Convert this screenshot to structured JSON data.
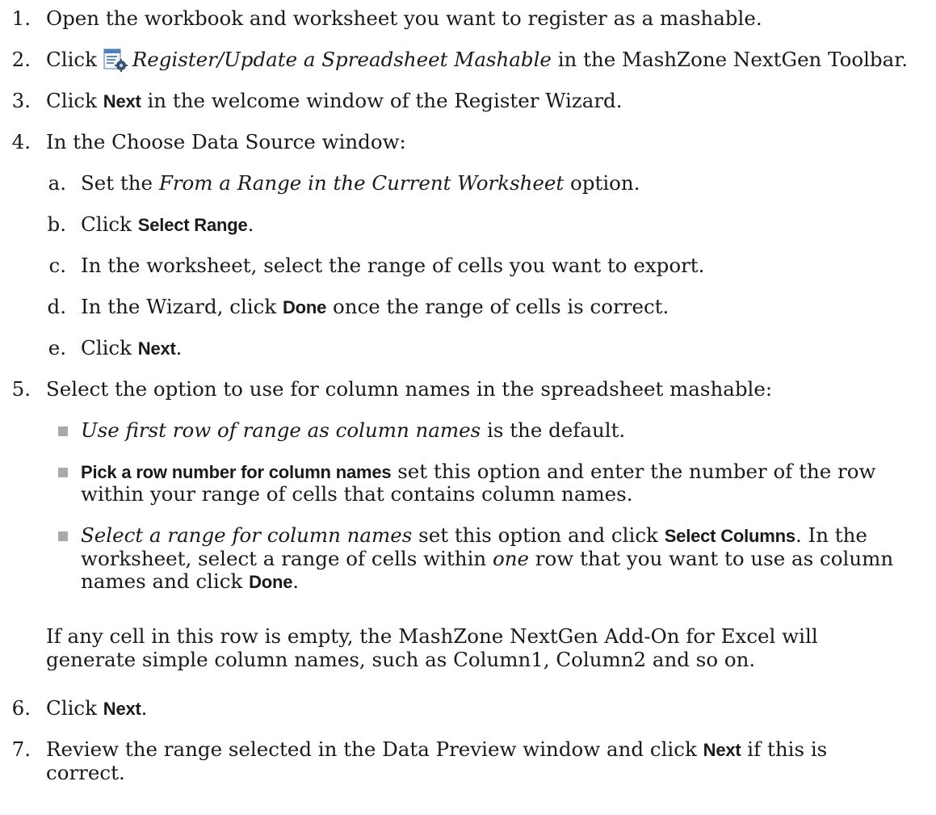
{
  "steps": [
    {
      "num": "1.",
      "text": "Open the workbook and worksheet you want to register as a mashable."
    },
    {
      "num": "2.",
      "pre": "Click ",
      "italic": "Register/Update a Spreadsheet Mashable",
      "post": " in the MashZone NextGen Toolbar.",
      "icon": "spreadsheet-register-icon"
    },
    {
      "num": "3.",
      "pre": "Click ",
      "bold": "Next",
      "post": " in the welcome window of the Register Wizard."
    },
    {
      "num": "4.",
      "text": "In the Choose Data Source window:"
    },
    {
      "num": "5.",
      "text": "Select the option to use for column names in the spreadsheet mashable:"
    },
    {
      "num": "6.",
      "pre": "Click ",
      "bold": "Next",
      "post": "."
    },
    {
      "num": "7.",
      "pre": "Review the range selected in the Data Preview window and click ",
      "bold": "Next",
      "post": " if this is",
      "cont": "correct."
    }
  ],
  "substeps": [
    {
      "letter": "a.",
      "pre": "Set the ",
      "italic": "From a Range in the Current Worksheet",
      "post": " option."
    },
    {
      "letter": "b.",
      "pre": "Click ",
      "bold": "Select Range",
      "post": "."
    },
    {
      "letter": "c.",
      "text": "In the worksheet, select the range of cells you want to export."
    },
    {
      "letter": "d.",
      "pre": "In the Wizard, click ",
      "bold": "Done",
      "post": " once the range of cells is correct."
    },
    {
      "letter": "e.",
      "pre": "Click ",
      "bold": "Next",
      "post": "."
    }
  ],
  "options": [
    {
      "italic": "Use first row of range as column names",
      "post": " is the default."
    },
    {
      "bold": "Pick a row number for column names",
      "post": " set this option and enter the number of the row",
      "cont": "within your range of cells that contains column names."
    },
    {
      "italic": "Select a range for column names",
      "mid": " set this option and click ",
      "bold": "Select Columns",
      "post": ". In the",
      "cont_pre": "worksheet, select a range of cells within ",
      "cont_italic": "one",
      "cont_post": " row that you want to use as column",
      "cont2_pre": "names and click ",
      "cont2_bold": "Done",
      "cont2_post": "."
    }
  ],
  "note": {
    "line1": "If any cell in this row is empty, the MashZone NextGen Add-On for Excel will",
    "line2": "generate simple column names, such as Column1, Column2 and so on."
  }
}
